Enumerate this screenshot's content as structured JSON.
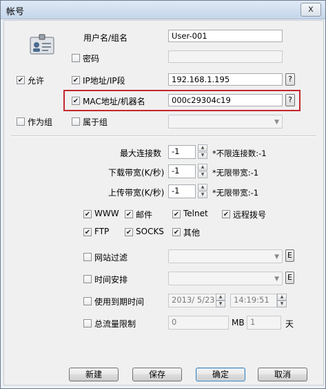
{
  "window": {
    "title": "帐号",
    "close": "x"
  },
  "account": {
    "username_label": "用户名/组名",
    "username_value": "User-001",
    "password_label": "密码",
    "password_checked": false,
    "allow_label": "允许",
    "allow_checked": true,
    "ip_label": "IP地址/IP段",
    "ip_checked": true,
    "ip_value": "192.168.1.195",
    "mac_label": "MAC地址/机器名",
    "mac_checked": true,
    "mac_value": "000c29304c19",
    "help": "?",
    "asgroup_label": "作为组",
    "asgroup_checked": false,
    "belong_label": "属于组",
    "belong_checked": false
  },
  "limits": {
    "max_conn_label": "最大连接数",
    "max_conn_value": "-1",
    "max_conn_hint": "*不限连接数:-1",
    "download_label": "下载带宽(K/秒)",
    "download_value": "-1",
    "download_hint": "*无限带宽:-1",
    "upload_label": "上传带宽(K/秒)",
    "upload_value": "-1",
    "upload_hint": "*无限带宽:-1"
  },
  "services": [
    {
      "label": "WWW",
      "checked": true
    },
    {
      "label": "邮件",
      "checked": true
    },
    {
      "label": "Telnet",
      "checked": true
    },
    {
      "label": "远程拨号",
      "checked": true
    },
    {
      "label": "FTP",
      "checked": true
    },
    {
      "label": "SOCKS",
      "checked": true
    },
    {
      "label": "其他",
      "checked": true
    }
  ],
  "options": {
    "web_filter_label": "网站过滤",
    "schedule_label": "时间安排",
    "e_button": "E",
    "expire_label": "使用到期时间",
    "expire_date": "2013/  5/23",
    "expire_time": "14:19:51",
    "traffic_label": "总流量限制",
    "traffic_value": "0",
    "traffic_unit_mb": "MB",
    "traffic_days": "1",
    "traffic_unit_day": "天"
  },
  "buttons": {
    "new": "新建",
    "save": "保存",
    "ok": "确定",
    "cancel": "取消"
  },
  "colors": {
    "highlight_border": "#c4262e"
  }
}
